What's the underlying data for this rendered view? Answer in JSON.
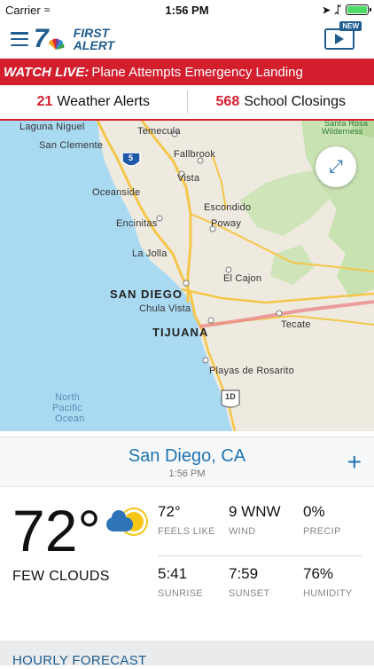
{
  "status": {
    "carrier": "Carrier",
    "time": "1:56 PM"
  },
  "header": {
    "logo_number": "7",
    "brand_line1": "FIRST",
    "brand_line2": "ALERT",
    "new_badge": "NEW"
  },
  "live": {
    "tag": "WATCH LIVE:",
    "headline": "Plane Attempts Emergency Landing"
  },
  "counts": {
    "alerts_num": "21",
    "alerts_label": "Weather Alerts",
    "closings_num": "568",
    "closings_label": "School Closings"
  },
  "map": {
    "labels": [
      "Laguna Niguel",
      "Temecula",
      "San Clemente",
      "Fallbrook",
      "Santa Rosa",
      "Wilderness",
      "5",
      "Vista",
      "Oceanside",
      "Escondido",
      "Poway",
      "Encinitas",
      "La Jolla",
      "El Cajon",
      "SAN DIEGO",
      "Chula Vista",
      "TIJUANA",
      "Tecate",
      "Playas de Rosarito",
      "1D",
      "North",
      "Pacific",
      "Ocean"
    ]
  },
  "location": {
    "city": "San Diego, CA",
    "time": "1:56 PM"
  },
  "current": {
    "temp": "72°",
    "condition": "FEW CLOUDS",
    "feels_like": "72°",
    "feels_like_label": "FEELS LIKE",
    "wind": "9 WNW",
    "wind_label": "WIND",
    "precip": "0%",
    "precip_label": "PRECIP",
    "sunrise": "5:41",
    "sunrise_label": "SUNRISE",
    "sunset": "7:59",
    "sunset_label": "SUNSET",
    "humidity": "76%",
    "humidity_label": "HUMIDITY"
  },
  "hourly": {
    "title": "HOURLY FORECAST"
  },
  "colors": {
    "brand": "#1f5c8f",
    "alert_red": "#d31e2e",
    "link_blue": "#1f73b0"
  }
}
